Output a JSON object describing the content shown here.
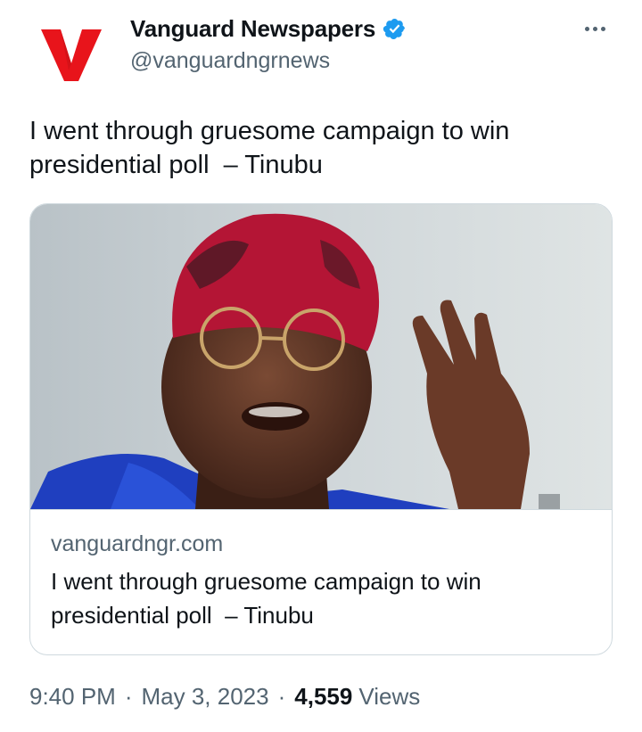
{
  "author": {
    "display_name": "Vanguard Newspapers",
    "handle": "@vanguardngrnews",
    "verified": true,
    "logo_letter": "V",
    "logo_color": "#e8141b"
  },
  "tweet": {
    "text": "I went through gruesome campaign to win\npresidential poll  – Tinubu"
  },
  "card": {
    "domain": "vanguardngr.com",
    "title": "I went through gruesome campaign to win\npresidential poll  – Tinubu",
    "image_icon": "news-photo"
  },
  "meta": {
    "time": "9:40 PM",
    "date": "May 3, 2023",
    "separator": "·",
    "views_count": "4,559",
    "views_label": "Views"
  },
  "icons": {
    "verified": "verified-badge-icon",
    "more": "more-options-icon"
  },
  "colors": {
    "text_primary": "#0f1419",
    "text_secondary": "#536471",
    "verified_blue": "#1d9bf0",
    "border": "#cfd9de"
  }
}
